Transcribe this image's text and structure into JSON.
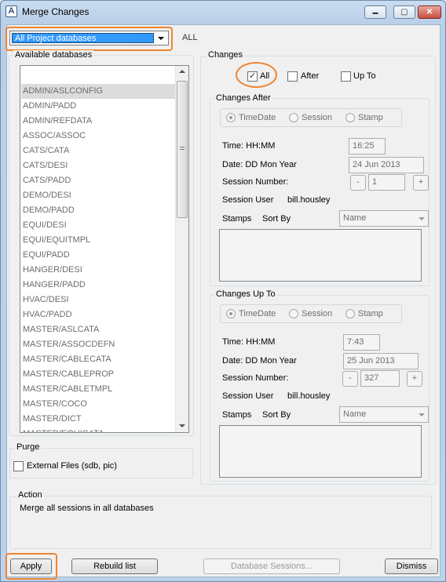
{
  "window": {
    "title": "Merge Changes",
    "app_icon_glyph": "A",
    "controls": {
      "minimize": "▬",
      "maximize": "▢",
      "close": "✕"
    }
  },
  "database_selector": {
    "selected": "All Project databases",
    "scope_label": "ALL"
  },
  "available_databases": {
    "label": "Available databases",
    "items": [
      "ADMIN/ASLCONFIG",
      "ADMIN/PADD",
      "ADMIN/REFDATA",
      "ASSOC/ASSOC",
      "CATS/CATA",
      "CATS/DESI",
      "CATS/PADD",
      "DEMO/DESI",
      "DEMO/PADD",
      "EQUI/DESI",
      "EQUI/EQUITMPL",
      "EQUI/PADD",
      "HANGER/DESI",
      "HANGER/PADD",
      "HVAC/DESI",
      "HVAC/PADD",
      "MASTER/ASLCATA",
      "MASTER/ASSOCDEFN",
      "MASTER/CABLECATA",
      "MASTER/CABLEPROP",
      "MASTER/CABLETMPL",
      "MASTER/COCO",
      "MASTER/DICT",
      "MASTER/EQUICATA"
    ],
    "selected_index": 0
  },
  "purge": {
    "label": "Purge",
    "external_files_label": "External Files (sdb, pic)"
  },
  "changes": {
    "label": "Changes",
    "all_label": "All",
    "after_label": "After",
    "up_to_label": "Up To",
    "all_checked": true
  },
  "changes_after": {
    "label": "Changes After",
    "radio_timedate": "TimeDate",
    "radio_session": "Session",
    "radio_stamp": "Stamp",
    "time_label": "Time: HH:MM",
    "time_value": "16:25",
    "date_label": "Date: DD Mon Year",
    "date_value": "24 Jun 2013",
    "session_number_label": "Session Number:",
    "session_number_value": "1",
    "session_user_label": "Session User",
    "session_user_value": "bill.housley",
    "stamps_label": "Stamps",
    "sort_by_label": "Sort By",
    "sort_by_value": "Name",
    "minus": "-",
    "plus": "+"
  },
  "changes_up_to": {
    "label": "Changes Up To",
    "radio_timedate": "TimeDate",
    "radio_session": "Session",
    "radio_stamp": "Stamp",
    "time_label": "Time: HH:MM",
    "time_value": "7:43",
    "date_label": "Date: DD Mon Year",
    "date_value": "25 Jun 2013",
    "session_number_label": "Session Number:",
    "session_number_value": "327",
    "session_user_label": "Session User",
    "session_user_value": "bill.housley",
    "stamps_label": "Stamps",
    "sort_by_label": "Sort By",
    "sort_by_value": "Name",
    "minus": "-",
    "plus": "+"
  },
  "action": {
    "label": "Action",
    "text": "Merge all sessions in all databases"
  },
  "buttons": {
    "apply": "Apply",
    "rebuild_list": "Rebuild list",
    "database_sessions": "Database Sessions...",
    "dismiss": "Dismiss"
  },
  "colors": {
    "highlight": "#ee8531",
    "selection": "#3399ff"
  }
}
